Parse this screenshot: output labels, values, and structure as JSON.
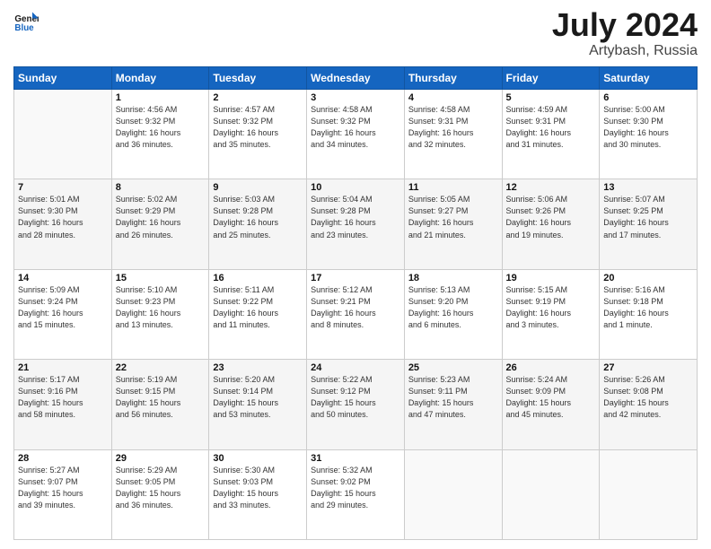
{
  "header": {
    "logo_line1": "General",
    "logo_line2": "Blue",
    "title": "July 2024",
    "subtitle": "Artybash, Russia"
  },
  "weekdays": [
    "Sunday",
    "Monday",
    "Tuesday",
    "Wednesday",
    "Thursday",
    "Friday",
    "Saturday"
  ],
  "weeks": [
    [
      {
        "day": "",
        "info": ""
      },
      {
        "day": "1",
        "info": "Sunrise: 4:56 AM\nSunset: 9:32 PM\nDaylight: 16 hours\nand 36 minutes."
      },
      {
        "day": "2",
        "info": "Sunrise: 4:57 AM\nSunset: 9:32 PM\nDaylight: 16 hours\nand 35 minutes."
      },
      {
        "day": "3",
        "info": "Sunrise: 4:58 AM\nSunset: 9:32 PM\nDaylight: 16 hours\nand 34 minutes."
      },
      {
        "day": "4",
        "info": "Sunrise: 4:58 AM\nSunset: 9:31 PM\nDaylight: 16 hours\nand 32 minutes."
      },
      {
        "day": "5",
        "info": "Sunrise: 4:59 AM\nSunset: 9:31 PM\nDaylight: 16 hours\nand 31 minutes."
      },
      {
        "day": "6",
        "info": "Sunrise: 5:00 AM\nSunset: 9:30 PM\nDaylight: 16 hours\nand 30 minutes."
      }
    ],
    [
      {
        "day": "7",
        "info": "Sunrise: 5:01 AM\nSunset: 9:30 PM\nDaylight: 16 hours\nand 28 minutes."
      },
      {
        "day": "8",
        "info": "Sunrise: 5:02 AM\nSunset: 9:29 PM\nDaylight: 16 hours\nand 26 minutes."
      },
      {
        "day": "9",
        "info": "Sunrise: 5:03 AM\nSunset: 9:28 PM\nDaylight: 16 hours\nand 25 minutes."
      },
      {
        "day": "10",
        "info": "Sunrise: 5:04 AM\nSunset: 9:28 PM\nDaylight: 16 hours\nand 23 minutes."
      },
      {
        "day": "11",
        "info": "Sunrise: 5:05 AM\nSunset: 9:27 PM\nDaylight: 16 hours\nand 21 minutes."
      },
      {
        "day": "12",
        "info": "Sunrise: 5:06 AM\nSunset: 9:26 PM\nDaylight: 16 hours\nand 19 minutes."
      },
      {
        "day": "13",
        "info": "Sunrise: 5:07 AM\nSunset: 9:25 PM\nDaylight: 16 hours\nand 17 minutes."
      }
    ],
    [
      {
        "day": "14",
        "info": "Sunrise: 5:09 AM\nSunset: 9:24 PM\nDaylight: 16 hours\nand 15 minutes."
      },
      {
        "day": "15",
        "info": "Sunrise: 5:10 AM\nSunset: 9:23 PM\nDaylight: 16 hours\nand 13 minutes."
      },
      {
        "day": "16",
        "info": "Sunrise: 5:11 AM\nSunset: 9:22 PM\nDaylight: 16 hours\nand 11 minutes."
      },
      {
        "day": "17",
        "info": "Sunrise: 5:12 AM\nSunset: 9:21 PM\nDaylight: 16 hours\nand 8 minutes."
      },
      {
        "day": "18",
        "info": "Sunrise: 5:13 AM\nSunset: 9:20 PM\nDaylight: 16 hours\nand 6 minutes."
      },
      {
        "day": "19",
        "info": "Sunrise: 5:15 AM\nSunset: 9:19 PM\nDaylight: 16 hours\nand 3 minutes."
      },
      {
        "day": "20",
        "info": "Sunrise: 5:16 AM\nSunset: 9:18 PM\nDaylight: 16 hours\nand 1 minute."
      }
    ],
    [
      {
        "day": "21",
        "info": "Sunrise: 5:17 AM\nSunset: 9:16 PM\nDaylight: 15 hours\nand 58 minutes."
      },
      {
        "day": "22",
        "info": "Sunrise: 5:19 AM\nSunset: 9:15 PM\nDaylight: 15 hours\nand 56 minutes."
      },
      {
        "day": "23",
        "info": "Sunrise: 5:20 AM\nSunset: 9:14 PM\nDaylight: 15 hours\nand 53 minutes."
      },
      {
        "day": "24",
        "info": "Sunrise: 5:22 AM\nSunset: 9:12 PM\nDaylight: 15 hours\nand 50 minutes."
      },
      {
        "day": "25",
        "info": "Sunrise: 5:23 AM\nSunset: 9:11 PM\nDaylight: 15 hours\nand 47 minutes."
      },
      {
        "day": "26",
        "info": "Sunrise: 5:24 AM\nSunset: 9:09 PM\nDaylight: 15 hours\nand 45 minutes."
      },
      {
        "day": "27",
        "info": "Sunrise: 5:26 AM\nSunset: 9:08 PM\nDaylight: 15 hours\nand 42 minutes."
      }
    ],
    [
      {
        "day": "28",
        "info": "Sunrise: 5:27 AM\nSunset: 9:07 PM\nDaylight: 15 hours\nand 39 minutes."
      },
      {
        "day": "29",
        "info": "Sunrise: 5:29 AM\nSunset: 9:05 PM\nDaylight: 15 hours\nand 36 minutes."
      },
      {
        "day": "30",
        "info": "Sunrise: 5:30 AM\nSunset: 9:03 PM\nDaylight: 15 hours\nand 33 minutes."
      },
      {
        "day": "31",
        "info": "Sunrise: 5:32 AM\nSunset: 9:02 PM\nDaylight: 15 hours\nand 29 minutes."
      },
      {
        "day": "",
        "info": ""
      },
      {
        "day": "",
        "info": ""
      },
      {
        "day": "",
        "info": ""
      }
    ]
  ]
}
